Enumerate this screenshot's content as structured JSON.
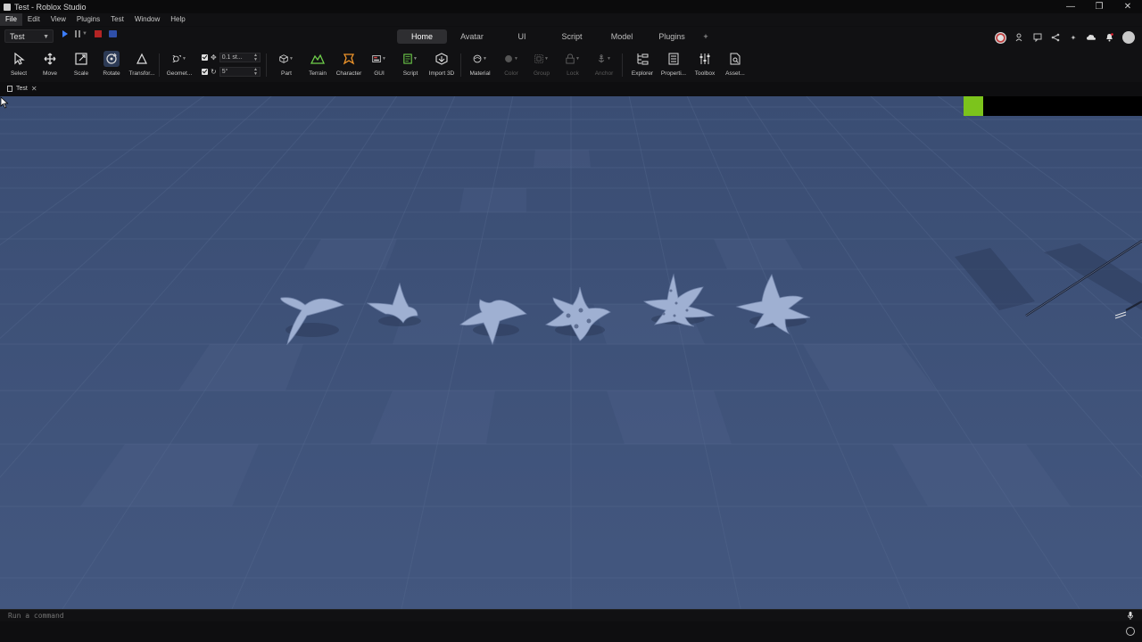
{
  "window": {
    "title": "Test - Roblox Studio",
    "controls": [
      "—",
      "❐",
      "✕"
    ]
  },
  "menu": [
    "File",
    "Edit",
    "View",
    "Plugins",
    "Test",
    "Window",
    "Help"
  ],
  "test_dropdown": {
    "value": "Test"
  },
  "tabs": [
    "Home",
    "Avatar",
    "UI",
    "Script",
    "Model",
    "Plugins",
    "+"
  ],
  "active_tab": "Home",
  "tools": {
    "select": "Select",
    "move": "Move",
    "scale": "Scale",
    "rotate": "Rotate",
    "transform": "Transfor...",
    "geometry": "Geomet...",
    "part": "Part",
    "terrain": "Terrain",
    "character": "Character",
    "gui": "GUI",
    "script": "Script",
    "import3d": "Import 3D",
    "material": "Material",
    "color": "Color",
    "group": "Group",
    "lock": "Lock",
    "anchor": "Anchor",
    "explorer": "Explorer",
    "properties": "Properti...",
    "toolbox": "Toolbox",
    "assets": "Asset..."
  },
  "snap": {
    "move": "0.1 st...",
    "rotate": "5°"
  },
  "doc_tab": {
    "label": "Test",
    "close": "✕"
  },
  "command": {
    "placeholder": "Run a command"
  },
  "colors": {
    "accent": "#3d7eff",
    "stop": "#b32424",
    "fps_bar": "#7cc41c",
    "baseplate": "#3e5279"
  }
}
